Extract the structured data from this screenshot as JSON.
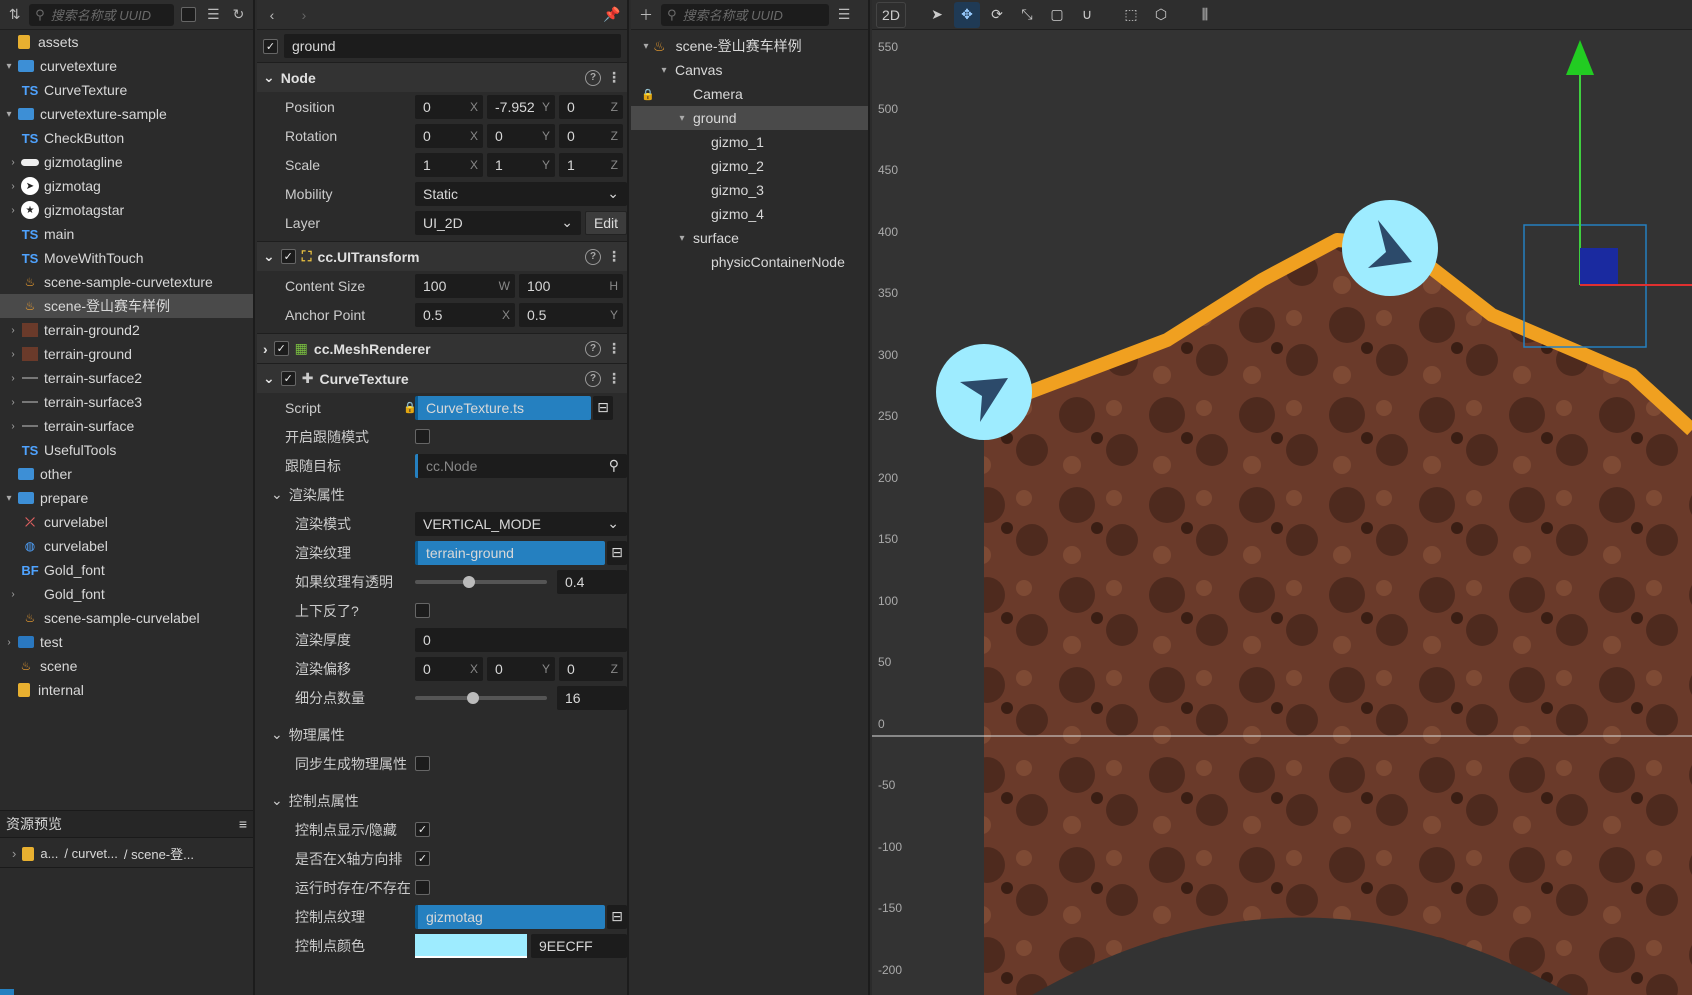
{
  "assets": {
    "search_placeholder": "搜索名称或 UUID",
    "items": [
      {
        "label": "assets",
        "icon": "db-icon",
        "indent": 0,
        "arrow": ""
      },
      {
        "label": "curvetexture",
        "icon": "folder-open-icon",
        "indent": 1,
        "arrow": "▾"
      },
      {
        "label": "CurveTexture",
        "icon": "ts-icon",
        "indent": 2,
        "arrow": ""
      },
      {
        "label": "curvetexture-sample",
        "icon": "folder-open-icon",
        "indent": 1,
        "arrow": "▾"
      },
      {
        "label": "CheckButton",
        "icon": "ts-icon",
        "indent": 2,
        "arrow": ""
      },
      {
        "label": "gizmotagline",
        "icon": "pill-icon",
        "indent": 2,
        "arrow": "›"
      },
      {
        "label": "gizmotag",
        "icon": "circle-arrow-icon",
        "indent": 2,
        "arrow": "›"
      },
      {
        "label": "gizmotagstar",
        "icon": "circle-star-icon",
        "indent": 2,
        "arrow": "›"
      },
      {
        "label": "main",
        "icon": "ts-icon",
        "indent": 2,
        "arrow": ""
      },
      {
        "label": "MoveWithTouch",
        "icon": "ts-icon",
        "indent": 2,
        "arrow": ""
      },
      {
        "label": "scene-sample-curvetexture",
        "icon": "fire-icon",
        "indent": 2,
        "arrow": ""
      },
      {
        "label": "scene-登山赛车样例",
        "icon": "fire-icon",
        "indent": 2,
        "arrow": "",
        "selected": true
      },
      {
        "label": "terrain-ground2",
        "icon": "thumb-icon",
        "indent": 2,
        "arrow": "›"
      },
      {
        "label": "terrain-ground",
        "icon": "thumb-icon",
        "indent": 2,
        "arrow": "›"
      },
      {
        "label": "terrain-surface2",
        "icon": "line-icon",
        "indent": 2,
        "arrow": "›"
      },
      {
        "label": "terrain-surface3",
        "icon": "line-icon",
        "indent": 2,
        "arrow": "›"
      },
      {
        "label": "terrain-surface",
        "icon": "line-icon",
        "indent": 2,
        "arrow": "›"
      },
      {
        "label": "UsefulTools",
        "icon": "ts-icon",
        "indent": 2,
        "arrow": ""
      },
      {
        "label": "other",
        "icon": "folder-open-icon",
        "indent": 1,
        "arrow": ""
      },
      {
        "label": "prepare",
        "icon": "folder-open-icon",
        "indent": 1,
        "arrow": "▾"
      },
      {
        "label": "curvelabel",
        "icon": "curve-icon",
        "indent": 2,
        "arrow": ""
      },
      {
        "label": "curvelabel",
        "icon": "globe-icon",
        "indent": 2,
        "arrow": ""
      },
      {
        "label": "Gold_font",
        "icon": "bf-icon",
        "indent": 2,
        "arrow": ""
      },
      {
        "label": "Gold_font",
        "icon": "none",
        "indent": 2,
        "arrow": "›"
      },
      {
        "label": "scene-sample-curvelabel",
        "icon": "fire-icon",
        "indent": 2,
        "arrow": ""
      },
      {
        "label": "test",
        "icon": "folder-icon",
        "indent": 1,
        "arrow": "›"
      },
      {
        "label": "scene",
        "icon": "fire-icon",
        "indent": 1,
        "arrow": ""
      },
      {
        "label": "internal",
        "icon": "db-icon",
        "indent": 0,
        "arrow": ""
      }
    ],
    "preview_title": "资源预览",
    "preview_path": [
      "a...",
      "/ curvet...",
      "/ scene-登..."
    ]
  },
  "inspector": {
    "node_name": "ground",
    "node_section": "Node",
    "position": {
      "label": "Position",
      "x": "0",
      "y": "-7.952",
      "z": "0"
    },
    "rotation": {
      "label": "Rotation",
      "x": "0",
      "y": "0",
      "z": "0"
    },
    "scale": {
      "label": "Scale",
      "x": "1",
      "y": "1",
      "z": "1"
    },
    "mobility": {
      "label": "Mobility",
      "value": "Static"
    },
    "layer": {
      "label": "Layer",
      "value": "UI_2D",
      "edit": "Edit"
    },
    "uitransform": {
      "title": "cc.UITransform",
      "content_label": "Content Size",
      "w": "100",
      "h": "100",
      "anchor_label": "Anchor Point",
      "ax": "0.5",
      "ay": "0.5"
    },
    "meshrenderer": {
      "title": "cc.MeshRenderer"
    },
    "curvetexture": {
      "title": "CurveTexture",
      "script_label": "Script",
      "script_value": "CurveTexture.ts",
      "follow_mode_label": "开启跟随模式",
      "follow_target_label": "跟随目标",
      "follow_target_value": "cc.Node",
      "render_props": "渲染属性",
      "render_mode_label": "渲染模式",
      "render_mode_value": "VERTICAL_MODE",
      "render_texture_label": "渲染纹理",
      "render_texture_value": "terrain-ground",
      "transparent_label": "如果纹理有透明",
      "transparent_value": "0.4",
      "transparent_ratio": 0.4,
      "flip_label": "上下反了?",
      "thickness_label": "渲染厚度",
      "thickness_value": "0",
      "offset_label": "渲染偏移",
      "offset_x": "0",
      "offset_y": "0",
      "offset_z": "0",
      "subdiv_label": "细分点数量",
      "subdiv_value": "16",
      "subdiv_ratio": 0.43,
      "physics_props": "物理属性",
      "sync_physics_label": "同步生成物理属性",
      "control_props": "控制点属性",
      "cp_show_label": "控制点显示/隐藏",
      "cp_sort_label": "是否在X轴方向排",
      "cp_runtime_label": "运行时存在/不存在",
      "cp_texture_label": "控制点纹理",
      "cp_texture_value": "gizmotag",
      "cp_color_label": "控制点颜色",
      "cp_color_value": "9EECFF",
      "cp_color": "#9EECFF"
    }
  },
  "hierarchy": {
    "search_placeholder": "搜索名称或 UUID",
    "items": [
      {
        "label": "scene-登山赛车样例",
        "indent": 0,
        "arrow": "▾",
        "icon": "fire-icon"
      },
      {
        "label": "Canvas",
        "indent": 1,
        "arrow": "▾"
      },
      {
        "label": "Camera",
        "indent": 2,
        "arrow": "",
        "lock": true
      },
      {
        "label": "ground",
        "indent": 2,
        "arrow": "▾",
        "selected": true
      },
      {
        "label": "gizmo_1",
        "indent": 3,
        "arrow": ""
      },
      {
        "label": "gizmo_2",
        "indent": 3,
        "arrow": ""
      },
      {
        "label": "gizmo_3",
        "indent": 3,
        "arrow": ""
      },
      {
        "label": "gizmo_4",
        "indent": 3,
        "arrow": ""
      },
      {
        "label": "surface",
        "indent": 2,
        "arrow": "▾"
      },
      {
        "label": "physicContainerNode",
        "indent": 3,
        "arrow": ""
      }
    ]
  },
  "scene": {
    "mode_label": "2D",
    "ruler": [
      "550",
      "500",
      "450",
      "400",
      "350",
      "300",
      "250",
      "200",
      "150",
      "100",
      "50",
      "0",
      "-50",
      "-100",
      "-150",
      "-200"
    ],
    "colors": {
      "ground": "#6a3a2a",
      "grass": "#f0a020",
      "gizmo": "#9EECFF",
      "gizmo_arrow": "#2c4a6a"
    }
  }
}
